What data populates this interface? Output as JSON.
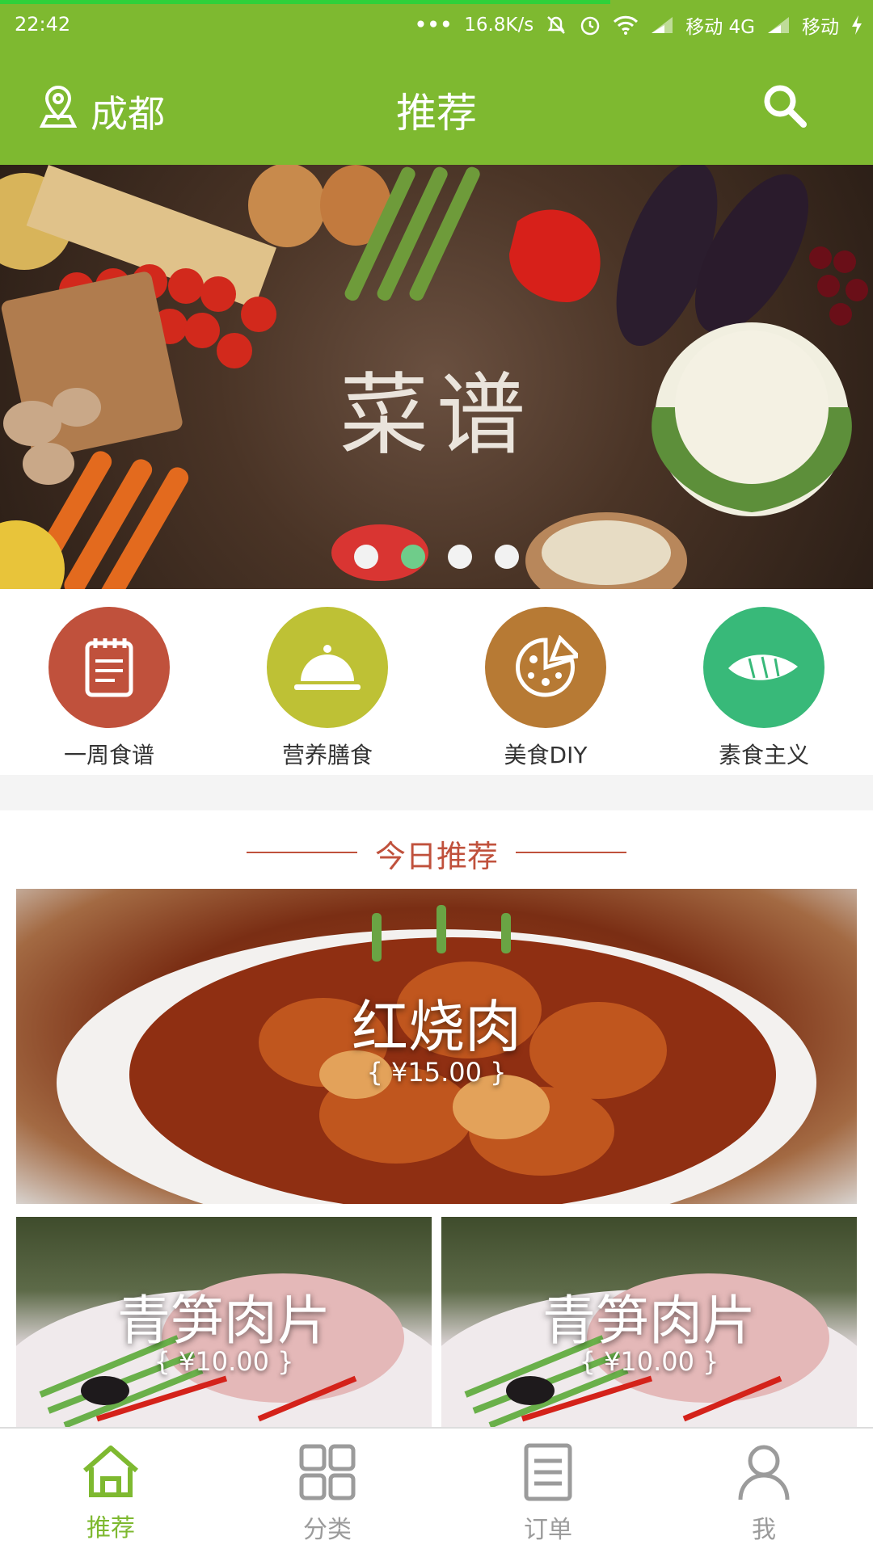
{
  "status_bar": {
    "time": "22:42",
    "dots": "•••",
    "speed": "16.8K/s",
    "carrier1": "移动 4G",
    "carrier2": "移动"
  },
  "header": {
    "city": "成都",
    "title": "推荐"
  },
  "banner": {
    "logo": "菜谱",
    "page_index": 2,
    "page_count": 4
  },
  "categories": [
    {
      "label": "一周食谱",
      "color": "#c0513c",
      "icon": "notepad-icon"
    },
    {
      "label": "营养膳食",
      "color": "#bec135",
      "icon": "serving-cloche-icon"
    },
    {
      "label": "美食DIY",
      "color": "#b77a34",
      "icon": "pizza-icon"
    },
    {
      "label": "素食主义",
      "color": "#38b979",
      "icon": "leaf-icon"
    }
  ],
  "today": {
    "title": "今日推荐",
    "featured": {
      "name": "红烧肉",
      "price": "{ ¥15.00 }"
    },
    "items": [
      {
        "name": "青笋肉片",
        "price": "{ ¥10.00 }"
      },
      {
        "name": "青笋肉片",
        "price": "{ ¥10.00 }"
      }
    ]
  },
  "bottom_nav": {
    "tabs": [
      {
        "label": "推荐",
        "icon": "home-icon",
        "active": true
      },
      {
        "label": "分类",
        "icon": "grid-icon",
        "active": false
      },
      {
        "label": "订单",
        "icon": "document-icon",
        "active": false
      },
      {
        "label": "我",
        "icon": "user-icon",
        "active": false
      }
    ]
  },
  "colors": {
    "brand": "#7eb930",
    "accent_red": "#c0513c",
    "inactive_gray": "#9b9b9b"
  }
}
